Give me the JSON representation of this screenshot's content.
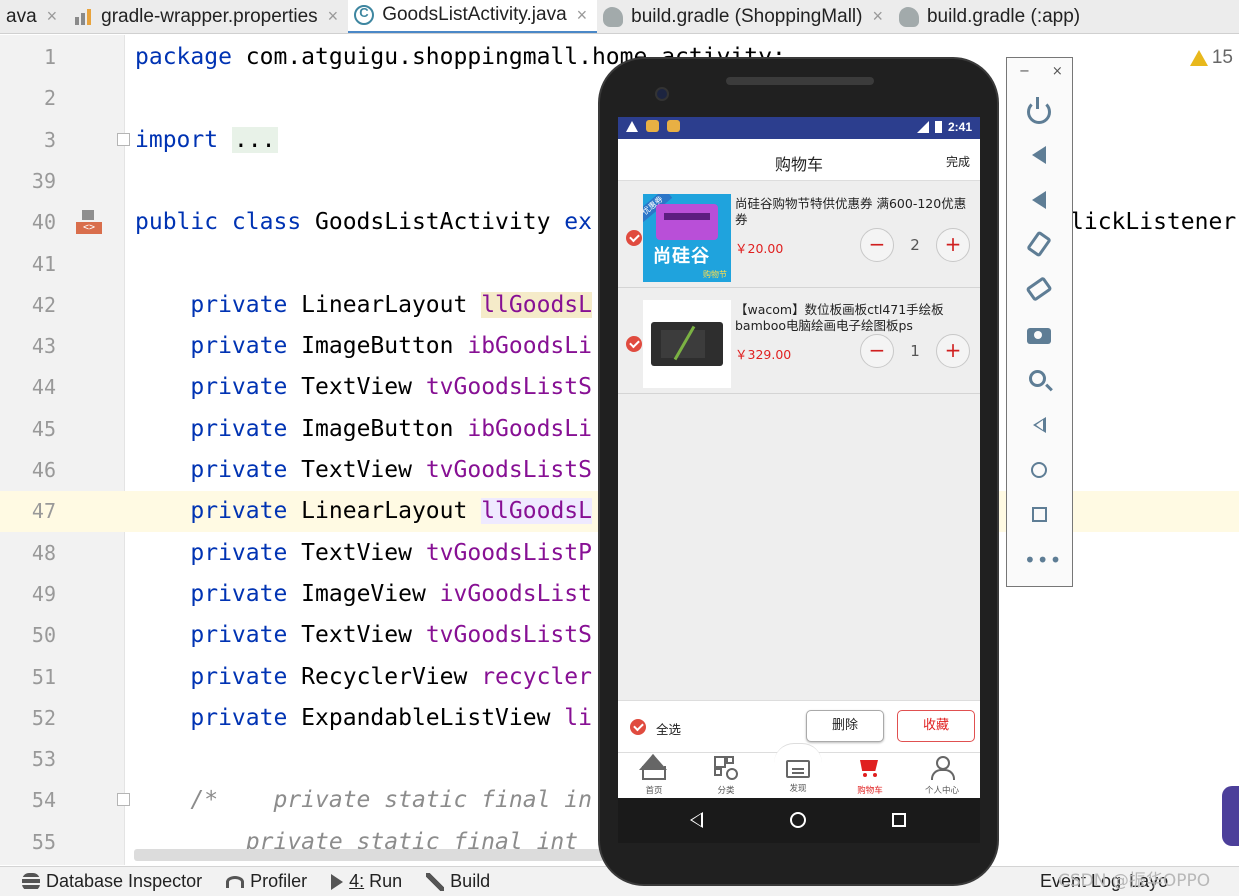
{
  "tabs": [
    {
      "label": "ava",
      "icon": "none",
      "active": false
    },
    {
      "label": "gradle-wrapper.properties",
      "icon": "properties-file-icon",
      "active": false
    },
    {
      "label": "GoodsListActivity.java",
      "icon": "java-class-icon",
      "active": true
    },
    {
      "label": "build.gradle (ShoppingMall)",
      "icon": "gradle-icon",
      "active": false
    },
    {
      "label": "build.gradle (:app)",
      "icon": "gradle-icon",
      "active": false
    }
  ],
  "tab_close_glyph": "×",
  "editor": {
    "warning_count": "15",
    "lines": [
      {
        "num": "1",
        "parts": [
          [
            "kw",
            "package"
          ],
          [
            "t",
            " com.atguigu.shoppingmall.home.activity;"
          ]
        ]
      },
      {
        "num": "2",
        "parts": []
      },
      {
        "num": "3",
        "parts": [
          [
            "kw",
            "import"
          ],
          [
            "t",
            " "
          ],
          [
            "hlg",
            "..."
          ]
        ]
      },
      {
        "num": "39",
        "parts": []
      },
      {
        "num": "40",
        "parts": [
          [
            "kw",
            "public class"
          ],
          [
            "t",
            " GoodsListActivity "
          ],
          [
            "kw",
            "ex"
          ]
        ]
      },
      {
        "num": "41",
        "parts": []
      },
      {
        "num": "42",
        "parts": [
          [
            "t",
            "    "
          ],
          [
            "kw",
            "private"
          ],
          [
            "t",
            " LinearLayout "
          ],
          [
            "hly",
            "llGoodsL"
          ]
        ]
      },
      {
        "num": "43",
        "parts": [
          [
            "t",
            "    "
          ],
          [
            "kw",
            "private"
          ],
          [
            "t",
            " ImageButton "
          ],
          [
            "fld",
            "ibGoodsLi"
          ]
        ]
      },
      {
        "num": "44",
        "parts": [
          [
            "t",
            "    "
          ],
          [
            "kw",
            "private"
          ],
          [
            "t",
            " TextView "
          ],
          [
            "fld",
            "tvGoodsListS"
          ]
        ]
      },
      {
        "num": "45",
        "parts": [
          [
            "t",
            "    "
          ],
          [
            "kw",
            "private"
          ],
          [
            "t",
            " ImageButton "
          ],
          [
            "fld",
            "ibGoodsLi"
          ]
        ]
      },
      {
        "num": "46",
        "parts": [
          [
            "t",
            "    "
          ],
          [
            "kw",
            "private"
          ],
          [
            "t",
            " TextView "
          ],
          [
            "fld",
            "tvGoodsListS"
          ]
        ]
      },
      {
        "num": "47",
        "parts": [
          [
            "t",
            "    "
          ],
          [
            "kw",
            "private"
          ],
          [
            "t",
            " LinearLayout "
          ],
          [
            "hll",
            "llGoodsL"
          ]
        ]
      },
      {
        "num": "48",
        "parts": [
          [
            "t",
            "    "
          ],
          [
            "kw",
            "private"
          ],
          [
            "t",
            " TextView "
          ],
          [
            "fld",
            "tvGoodsListP"
          ]
        ]
      },
      {
        "num": "49",
        "parts": [
          [
            "t",
            "    "
          ],
          [
            "kw",
            "private"
          ],
          [
            "t",
            " ImageView "
          ],
          [
            "fld",
            "ivGoodsList"
          ]
        ]
      },
      {
        "num": "50",
        "parts": [
          [
            "t",
            "    "
          ],
          [
            "kw",
            "private"
          ],
          [
            "t",
            " TextView "
          ],
          [
            "fld",
            "tvGoodsListS"
          ]
        ]
      },
      {
        "num": "51",
        "parts": [
          [
            "t",
            "    "
          ],
          [
            "kw",
            "private"
          ],
          [
            "t",
            " RecyclerView "
          ],
          [
            "fld",
            "recycler"
          ]
        ]
      },
      {
        "num": "52",
        "parts": [
          [
            "t",
            "    "
          ],
          [
            "kw",
            "private"
          ],
          [
            "t",
            " ExpandableListView "
          ],
          [
            "fld",
            "li"
          ]
        ]
      },
      {
        "num": "53",
        "parts": []
      },
      {
        "num": "54",
        "parts": [
          [
            "cmt",
            "    /*    private static final in"
          ]
        ]
      },
      {
        "num": "55",
        "parts": [
          [
            "cmt",
            "        private static final int "
          ]
        ]
      }
    ],
    "line40_right_fragment": "lickListener",
    "current_line": "47"
  },
  "statusbar": {
    "items": [
      {
        "label": "Database Inspector",
        "icon": "database-icon"
      },
      {
        "label": "Profiler",
        "icon": "profiler-icon"
      },
      {
        "label": "Run",
        "prefix": "4:",
        "icon": "run-icon"
      },
      {
        "label": "Build",
        "icon": "hammer-icon"
      }
    ],
    "event_log": "Event Log",
    "layout_inspector": "Layo",
    "watermark": "CSDN @振华OPPO"
  },
  "phone": {
    "status_time": "2:41",
    "title": "购物车",
    "done_label": "完成",
    "items": [
      {
        "name": "尚硅谷购物节特供优惠券  满600-120优惠券",
        "price": "￥20.00",
        "qty": "2",
        "checked": true,
        "thumb_text": "尚硅谷",
        "thumb_flag": "优惠券",
        "thumb_tag": "购物节"
      },
      {
        "name": "【wacom】数位板画板ctl471手绘板bamboo电脑绘画电子绘图板ps",
        "price": "￥329.00",
        "qty": "1",
        "checked": true
      }
    ],
    "minus": "−",
    "plus": "+",
    "select_all": "全选",
    "delete_label": "删除",
    "favorite_label": "收藏",
    "nav": [
      {
        "label": "首页",
        "icon": "home-icon",
        "active": false
      },
      {
        "label": "分类",
        "icon": "category-icon",
        "active": false
      },
      {
        "label": "发现",
        "icon": "discover-icon",
        "active": false
      },
      {
        "label": "购物车",
        "icon": "cart-icon",
        "active": true
      },
      {
        "label": "个人中心",
        "icon": "user-icon",
        "active": false
      }
    ],
    "colors": {
      "accent": "#e02020",
      "statusbar": "#2c3e8e"
    }
  },
  "emulator_toolbar": {
    "minimize": "−",
    "close": "×",
    "buttons": [
      "power-icon",
      "volume-up-icon",
      "volume-down-icon",
      "rotate-left-icon",
      "rotate-right-icon",
      "screenshot-icon",
      "zoom-icon",
      "back-icon",
      "home-icon",
      "overview-icon",
      "more-icon"
    ],
    "more_glyph": "•••"
  }
}
